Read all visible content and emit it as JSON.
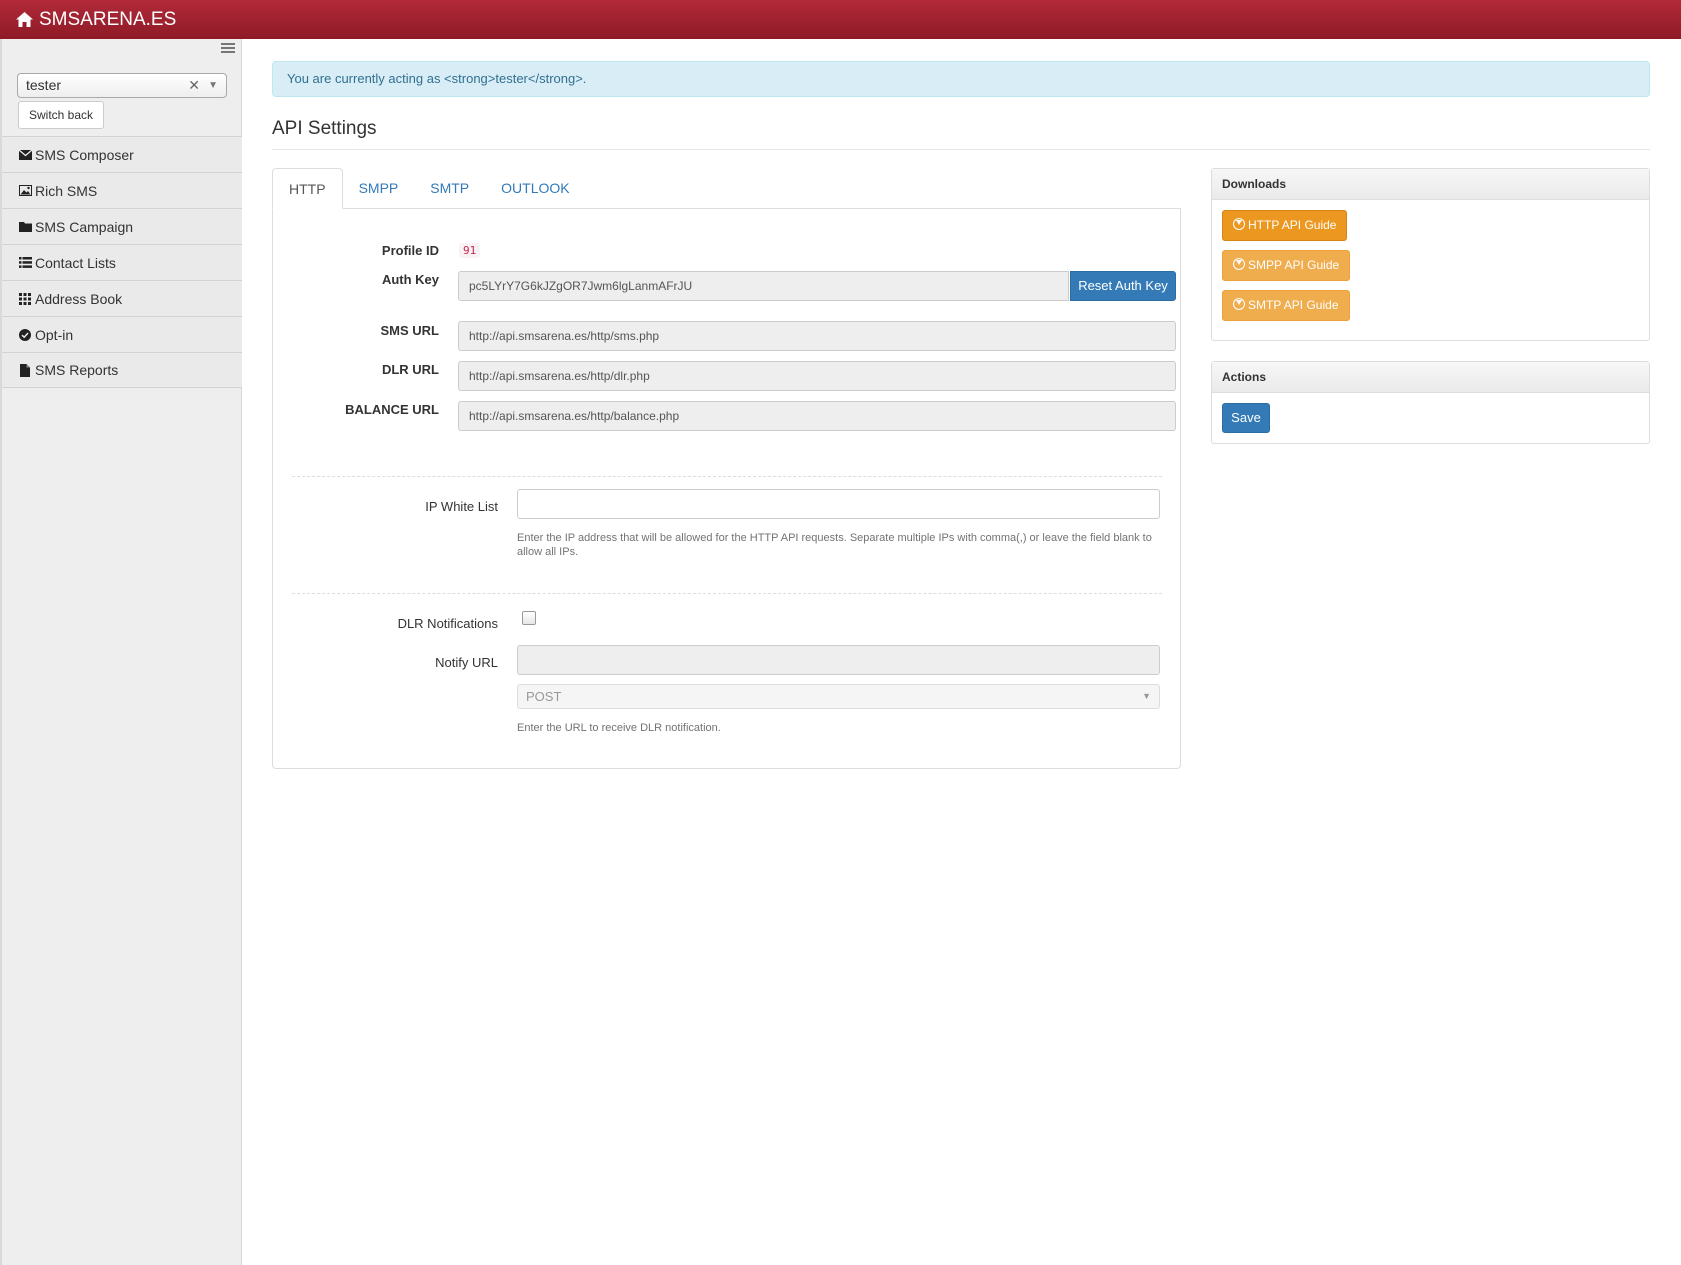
{
  "topbar": {
    "brand": "SMSARENA.ES",
    "home_icon": "home-icon"
  },
  "sidebar": {
    "user_select_value": "tester",
    "switch_back_label": "Switch back",
    "items": [
      {
        "label": "SMS Composer",
        "icon": "envelope-icon"
      },
      {
        "label": "Rich SMS",
        "icon": "picture-icon"
      },
      {
        "label": "SMS Campaign",
        "icon": "folder-icon"
      },
      {
        "label": "Contact Lists",
        "icon": "list-icon"
      },
      {
        "label": "Address Book",
        "icon": "grid-icon"
      },
      {
        "label": "Opt-in",
        "icon": "check-circle-icon"
      },
      {
        "label": "SMS Reports",
        "icon": "file-icon"
      }
    ]
  },
  "alert": {
    "text": "You are currently acting as <strong>tester</strong>."
  },
  "page": {
    "title": "API Settings"
  },
  "tabs": [
    "HTTP",
    "SMPP",
    "SMTP",
    "OUTLOOK"
  ],
  "http": {
    "profile_id_label": "Profile ID",
    "profile_id": "91",
    "auth_key_label": "Auth Key",
    "auth_key": "pc5LYrY7G6kJZgOR7Jwm6lgLanmAFrJU",
    "reset_auth_key_label": "Reset Auth Key",
    "sms_url_label": "SMS URL",
    "sms_url": "http://api.smsarena.es/http/sms.php",
    "dlr_url_label": "DLR URL",
    "dlr_url": "http://api.smsarena.es/http/dlr.php",
    "balance_url_label": "BALANCE URL",
    "balance_url": "http://api.smsarena.es/http/balance.php",
    "ip_white_list_label": "IP White List",
    "ip_white_list_value": "",
    "ip_help": "Enter the IP address that will be allowed for the HTTP API requests. Separate multiple IPs with comma(,) or leave the field blank to allow all IPs.",
    "dlr_notifications_label": "DLR Notifications",
    "dlr_notifications_checked": false,
    "notify_url_label": "Notify URL",
    "notify_method": "POST",
    "notify_help": "Enter the URL to receive DLR notification."
  },
  "downloads": {
    "title": "Downloads",
    "buttons": [
      "HTTP API Guide",
      "SMPP API Guide",
      "SMTP API Guide"
    ]
  },
  "actions": {
    "title": "Actions",
    "save_label": "Save"
  },
  "colors": {
    "topbar": "#a0202f",
    "primary": "#337ab7",
    "warning": "#f0ad4e",
    "alert_bg": "#d9edf7"
  }
}
